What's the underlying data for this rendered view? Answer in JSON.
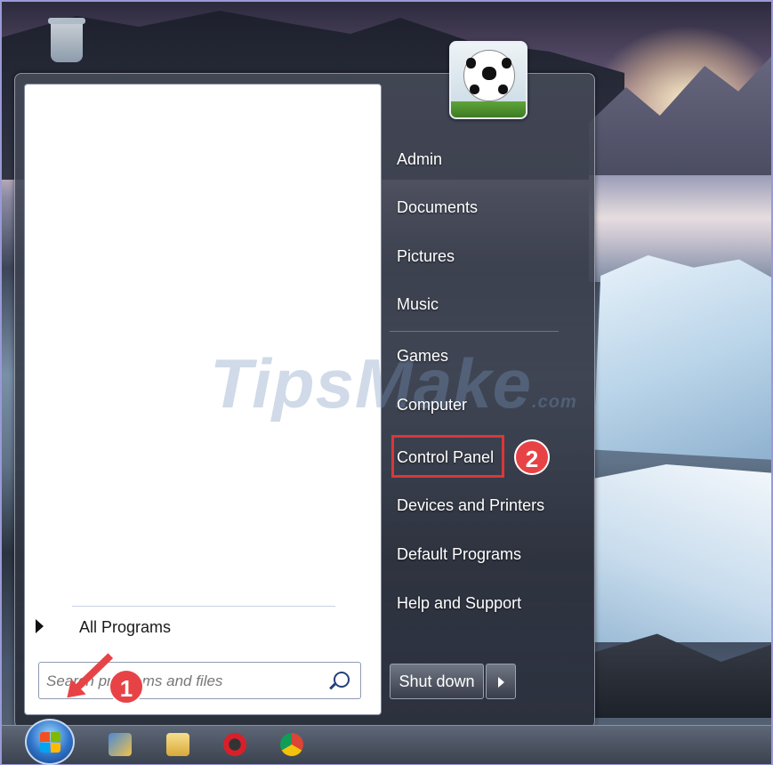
{
  "watermark": {
    "text": "TipsMake",
    "suffix": ".com"
  },
  "start_menu": {
    "all_programs_label": "All Programs",
    "search": {
      "placeholder": "Search programs and files",
      "value": ""
    },
    "right_items": [
      "Admin",
      "Documents",
      "Pictures",
      "Music",
      "Games",
      "Computer",
      "Control Panel",
      "Devices and Printers",
      "Default Programs",
      "Help and Support"
    ],
    "shutdown_label": "Shut down",
    "user_picture_icon": "soccer-ball-icon"
  },
  "annotations": {
    "step1": "1",
    "step2": "2",
    "highlight_color": "#d9373a",
    "badge_color": "#e74346"
  },
  "taskbar": {
    "icons": [
      "windows-start-orb-icon",
      "network-app-icon",
      "file-explorer-icon",
      "opera-browser-icon",
      "chrome-browser-icon"
    ]
  },
  "desktop": {
    "icons": [
      "recycle-bin-icon"
    ]
  }
}
